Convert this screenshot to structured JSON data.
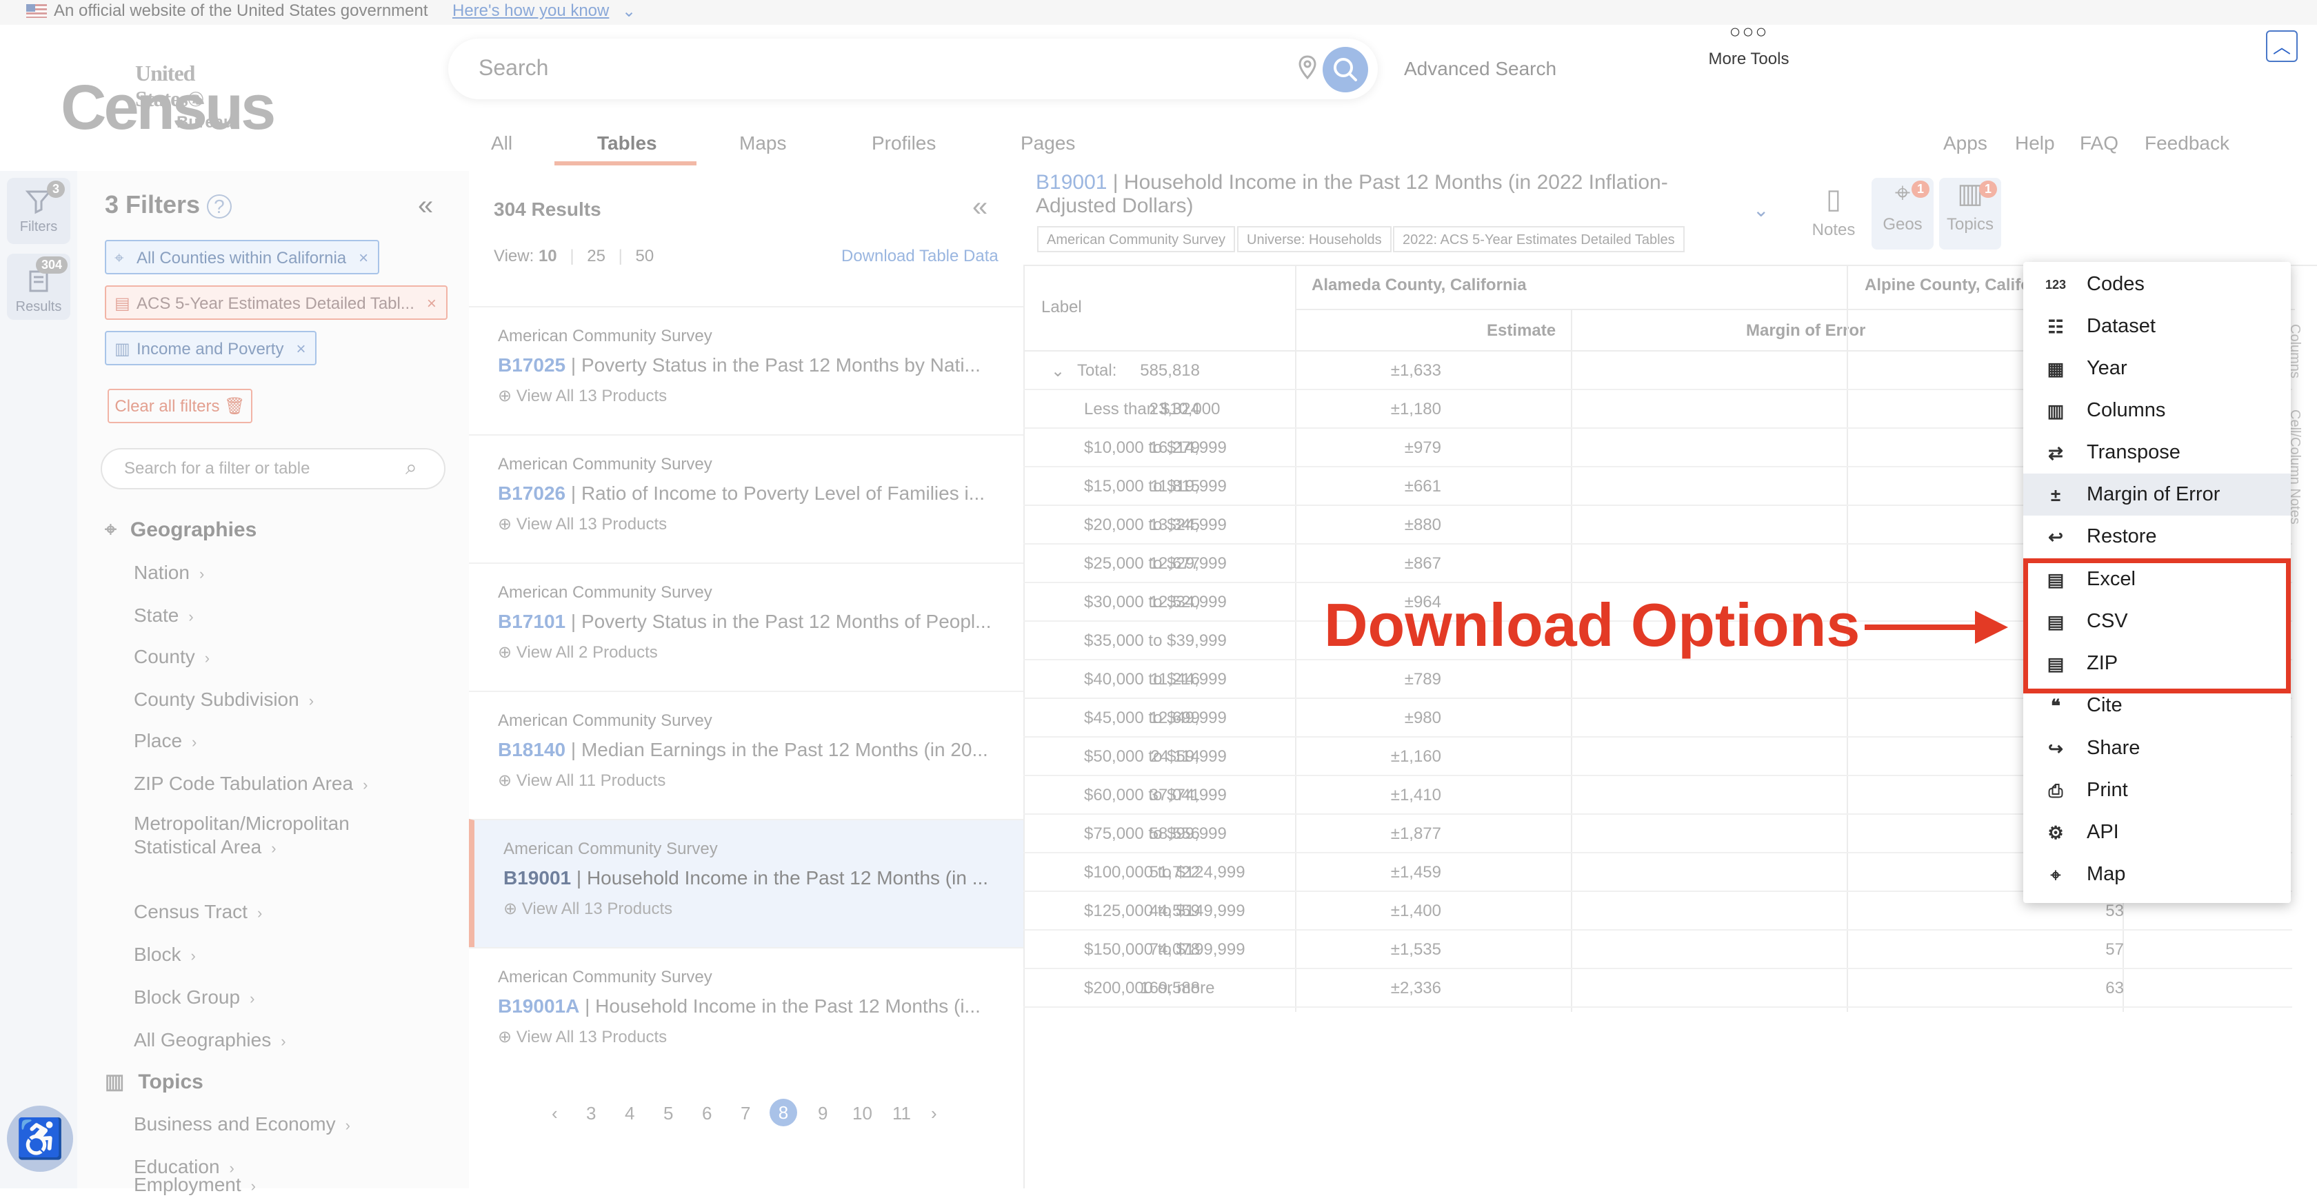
{
  "gov_banner": {
    "text": "An official website of the United States government",
    "link": "Here's how you know"
  },
  "logo": {
    "line1": "United States®",
    "line2": "Census",
    "line3": "Bureau"
  },
  "search": {
    "placeholder": "Search",
    "advanced": "Advanced Search"
  },
  "nav_tabs": [
    "All",
    "Tables",
    "Maps",
    "Profiles",
    "Pages"
  ],
  "nav_active": "Tables",
  "right_links": [
    "Apps",
    "Help",
    "FAQ",
    "Feedback"
  ],
  "rail": {
    "filters_label": "Filters",
    "filters_count": "3",
    "results_label": "Results",
    "results_count": "304"
  },
  "filters": {
    "title": "3 Filters",
    "chips": [
      "All Counties within California",
      "ACS 5-Year Estimates Detailed Tabl...",
      "Income and Poverty"
    ],
    "clear": "Clear all filters",
    "search_placeholder": "Search for a filter or table",
    "geographies_heading": "Geographies",
    "geo_items": [
      "Nation",
      "State",
      "County",
      "County Subdivision",
      "Place",
      "ZIP Code Tabulation Area",
      "Metropolitan/Micropolitan",
      "Statistical Area",
      "Census Tract",
      "Block",
      "Block Group",
      "All Geographies"
    ],
    "topics_heading": "Topics",
    "topic_items": [
      "Business and Economy",
      "Education",
      "Employment"
    ]
  },
  "results": {
    "count": "304 Results",
    "view_label": "View:",
    "view_options": [
      "10",
      "25",
      "50"
    ],
    "download": "Download Table Data",
    "cards": [
      {
        "source": "American Community Survey",
        "id": "B17025",
        "title": "Poverty Status in the Past 12 Months by Nati...",
        "more": "View All 13 Products"
      },
      {
        "source": "American Community Survey",
        "id": "B17026",
        "title": "Ratio of Income to Poverty Level of Families i...",
        "more": "View All 13 Products"
      },
      {
        "source": "American Community Survey",
        "id": "B17101",
        "title": "Poverty Status in the Past 12 Months of Peopl...",
        "more": "View All 2 Products"
      },
      {
        "source": "American Community Survey",
        "id": "B18140",
        "title": "Median Earnings in the Past 12 Months (in 20...",
        "more": "View All 11 Products"
      },
      {
        "source": "American Community Survey",
        "id": "B19001",
        "title": "Household Income in the Past 12 Months (in ...",
        "more": "View All 13 Products"
      },
      {
        "source": "American Community Survey",
        "id": "B19001A",
        "title": "Household Income in the Past 12 Months (i...",
        "more": "View All 13 Products"
      }
    ],
    "pages": [
      "3",
      "4",
      "5",
      "6",
      "7",
      "8",
      "9",
      "10",
      "11"
    ],
    "current_page": "8"
  },
  "table": {
    "id": "B19001",
    "title": "Household Income in the Past 12 Months (in 2022 Inflation-Adjusted Dollars)",
    "tags": [
      "American Community Survey",
      "Universe: Households",
      "2022: ACS 5-Year Estimates Detailed Tables"
    ],
    "buttons": {
      "notes": "Notes",
      "geos": "Geos",
      "geos_badge": "1",
      "topics": "Topics",
      "topics_badge": "1",
      "more": "More Tools"
    },
    "col_label": "Label",
    "county1": "Alameda County, California",
    "county2": "Alpine County, Califo",
    "estimate": "Estimate",
    "moe": "Margin of Error",
    "rows": [
      {
        "label": "Total:",
        "est": "585,818",
        "moe": "±1,633",
        "alp": ""
      },
      {
        "label": "Less than $10,000",
        "est": "23,324",
        "moe": "±1,180",
        "alp": ""
      },
      {
        "label": "$10,000 to $14,999",
        "est": "16,279",
        "moe": "±979",
        "alp": ""
      },
      {
        "label": "$15,000 to $19,999",
        "est": "11,815",
        "moe": "±661",
        "alp": ""
      },
      {
        "label": "$20,000 to $24,999",
        "est": "13,345",
        "moe": "±880",
        "alp": ""
      },
      {
        "label": "$25,000 to $29,999",
        "est": "12,677",
        "moe": "±867",
        "alp": ""
      },
      {
        "label": "$30,000 to $34,999",
        "est": "12,520",
        "moe": "±964",
        "alp": ""
      },
      {
        "label": "$35,000 to $39,999",
        "est": "",
        "moe": "",
        "alp": ""
      },
      {
        "label": "$40,000 to $44,999",
        "est": "11,216",
        "moe": "±789",
        "alp": ""
      },
      {
        "label": "$45,000 to $49,999",
        "est": "12,699",
        "moe": "±980",
        "alp": ""
      },
      {
        "label": "$50,000 to $59,999",
        "est": "24,114",
        "moe": "±1,160",
        "alp": ""
      },
      {
        "label": "$60,000 to $74,999",
        "est": "37,041",
        "moe": "±1,410",
        "alp": ""
      },
      {
        "label": "$75,000 to $99,999",
        "est": "58,556",
        "moe": "±1,877",
        "alp": ""
      },
      {
        "label": "$100,000 to $124,999",
        "est": "51,722",
        "moe": "±1,459",
        "alp": ""
      },
      {
        "label": "$125,000 to $149,999",
        "est": "44,559",
        "moe": "±1,400",
        "alp": "53"
      },
      {
        "label": "$150,000 to $199,999",
        "est": "74,078",
        "moe": "±1,535",
        "alp": "57"
      },
      {
        "label": "$200,000 or more",
        "est": "169,588",
        "moe": "±2,336",
        "alp": "63"
      }
    ],
    "side_tabs": [
      "Columns",
      "Cell/Column Notes"
    ]
  },
  "menu": {
    "items": [
      {
        "label": "Codes",
        "icon": "123"
      },
      {
        "label": "Dataset",
        "icon": "☷"
      },
      {
        "label": "Year",
        "icon": "▦"
      },
      {
        "label": "Columns",
        "icon": "▥"
      },
      {
        "label": "Transpose",
        "icon": "⇄"
      },
      {
        "label": "Margin of Error",
        "icon": "±"
      },
      {
        "label": "Restore",
        "icon": "↩"
      },
      {
        "label": "Excel",
        "icon": "▤"
      },
      {
        "label": "CSV",
        "icon": "▤"
      },
      {
        "label": "ZIP",
        "icon": "▤"
      },
      {
        "label": "Cite",
        "icon": "❝"
      },
      {
        "label": "Share",
        "icon": "↪"
      },
      {
        "label": "Print",
        "icon": "⎙"
      },
      {
        "label": "API",
        "icon": "⚙"
      },
      {
        "label": "Map",
        "icon": "⌖"
      }
    ],
    "highlighted": "Margin of Error"
  },
  "callout": "Download Options",
  "colors": {
    "accent_red": "#e33a25",
    "brand_blue": "#2c63c7"
  }
}
